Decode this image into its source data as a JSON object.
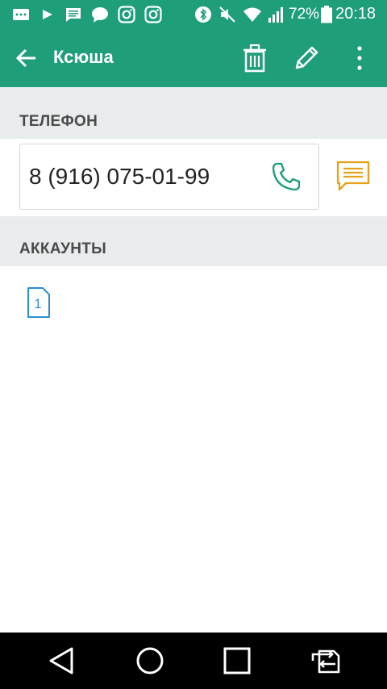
{
  "status_bar": {
    "battery_percent": "72%",
    "time": "20:18",
    "notification_icons": [
      "more-chat-icon",
      "play-icon",
      "message-icon",
      "chat-bubble-icon",
      "instagram-icon",
      "instagram-icon"
    ],
    "system_icons": [
      "bluetooth-icon",
      "mute-icon",
      "wifi-icon",
      "signal-icon",
      "battery-icon"
    ]
  },
  "app_bar": {
    "title": "Ксюша",
    "back_icon": "back-arrow-icon",
    "actions": [
      "delete-icon",
      "edit-icon",
      "more-vert-icon"
    ]
  },
  "phone_section": {
    "header": "ТЕЛЕФОН",
    "number": "8 (916) 075-01-99",
    "call_icon": "phone-call-icon",
    "message_icon": "message-icon"
  },
  "accounts_section": {
    "header": "АККАУНТЫ",
    "sim_label": "1"
  },
  "nav_bar": {
    "buttons": [
      "back-icon",
      "home-icon",
      "recents-icon",
      "switch-sim-icon"
    ]
  },
  "colors": {
    "primary": "#1f9e7a",
    "section_bg": "#e8eced",
    "call_icon": "#1f9e7a",
    "message_icon": "#e5a11a",
    "sim_icon": "#2a8fd6"
  }
}
